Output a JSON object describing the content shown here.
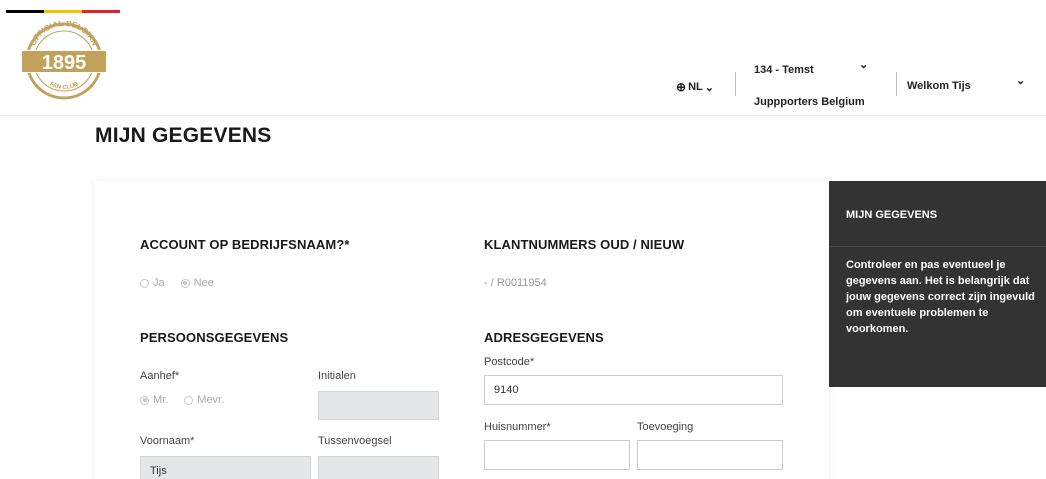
{
  "colors": {
    "flag_black": "#000000",
    "flag_yellow": "#f2c500",
    "flag_red": "#e4202a",
    "logo_gold": "#c2a25a",
    "sidebar_bg": "#333333"
  },
  "logo": {
    "arc_top": "OFFICIAL BELGIAN",
    "year": "1895",
    "arc_bottom": "FAN CLUB"
  },
  "header": {
    "language": "NL",
    "club_name": "134 - Temst",
    "club_sub": "Juppporters Belgium",
    "welcome": "Welkom Tijs"
  },
  "page": {
    "title": "MIJN GEGEVENS"
  },
  "form": {
    "company_account": {
      "heading": "ACCOUNT OP BEDRIJFSNAAM?*",
      "options": [
        "Ja",
        "Nee"
      ],
      "selected": "Nee"
    },
    "customer_numbers": {
      "heading": "KLANTNUMMERS OUD / NIEUW",
      "value": "- / R0011954"
    },
    "personal": {
      "heading": "PERSOONSGEGEVENS",
      "salutation_label": "Aanhef*",
      "salutation_options": [
        "Mr.",
        "Mevr."
      ],
      "salutation_selected": "Mr.",
      "initials_label": "Initialen",
      "initials_value": "",
      "firstname_label": "Voornaam*",
      "firstname_value": "Tijs",
      "infix_label": "Tussenvoegsel",
      "infix_value": ""
    },
    "address": {
      "heading": "ADRESGEGEVENS",
      "postcode_label": "Postcode*",
      "postcode_value": "9140",
      "housenumber_label": "Huisnummer*",
      "housenumber_value": "",
      "addition_label": "Toevoeging",
      "addition_value": ""
    }
  },
  "sidebar": {
    "title": "MIJN GEGEVENS",
    "text": "Controleer en pas eventueel je gegevens aan. Het is belangrijk dat jouw gegevens correct zijn ingevuld om eventuele problemen te voorkomen."
  }
}
